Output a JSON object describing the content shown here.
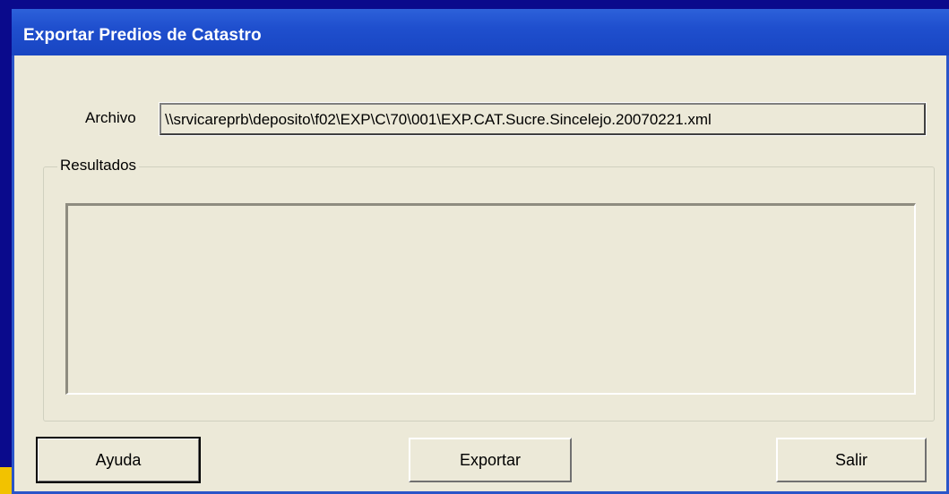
{
  "window": {
    "title": "Exportar Predios de Catastro"
  },
  "archivo": {
    "label": "Archivo",
    "value": "\\\\srvicareprb\\deposito\\f02\\EXP\\C\\70\\001\\EXP.CAT.Sucre.Sincelejo.20070221.xml"
  },
  "resultados": {
    "label": "Resultados",
    "content": ""
  },
  "buttons": {
    "ayuda": "Ayuda",
    "exportar": "Exportar",
    "salir": "Salir"
  },
  "colors": {
    "title_bar": "#1f4fce",
    "dialog_face": "#ece9d8",
    "desktop": "#0a0a8c"
  }
}
